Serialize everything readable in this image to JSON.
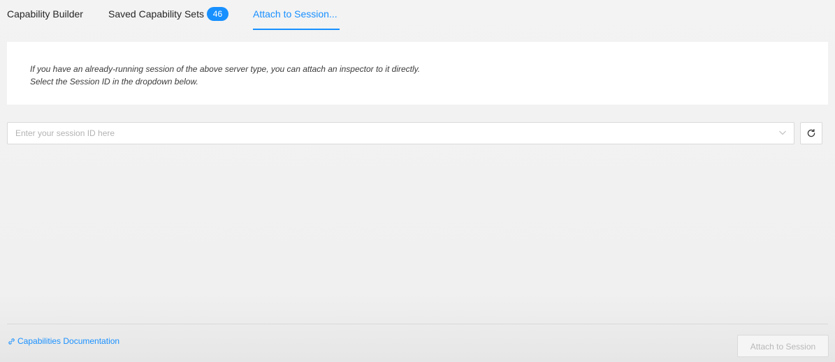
{
  "tabs": [
    {
      "label": "Capability Builder"
    },
    {
      "label": "Saved Capability Sets",
      "badge": "46"
    },
    {
      "label": "Attach to Session...",
      "active": true
    }
  ],
  "info": {
    "line1": "If you have an already-running session of the above server type, you can attach an inspector to it directly.",
    "line2": "Select the Session ID in the dropdown below."
  },
  "session": {
    "placeholder": "Enter your session ID here",
    "value": ""
  },
  "footer": {
    "doc_link": "Capabilities Documentation",
    "attach_button": "Attach to Session"
  },
  "colors": {
    "accent": "#1890ff",
    "disabled_text": "#b8b8b8"
  },
  "icons": {
    "dropdown": "chevron-down-icon",
    "refresh": "refresh-icon",
    "link": "link-icon"
  }
}
